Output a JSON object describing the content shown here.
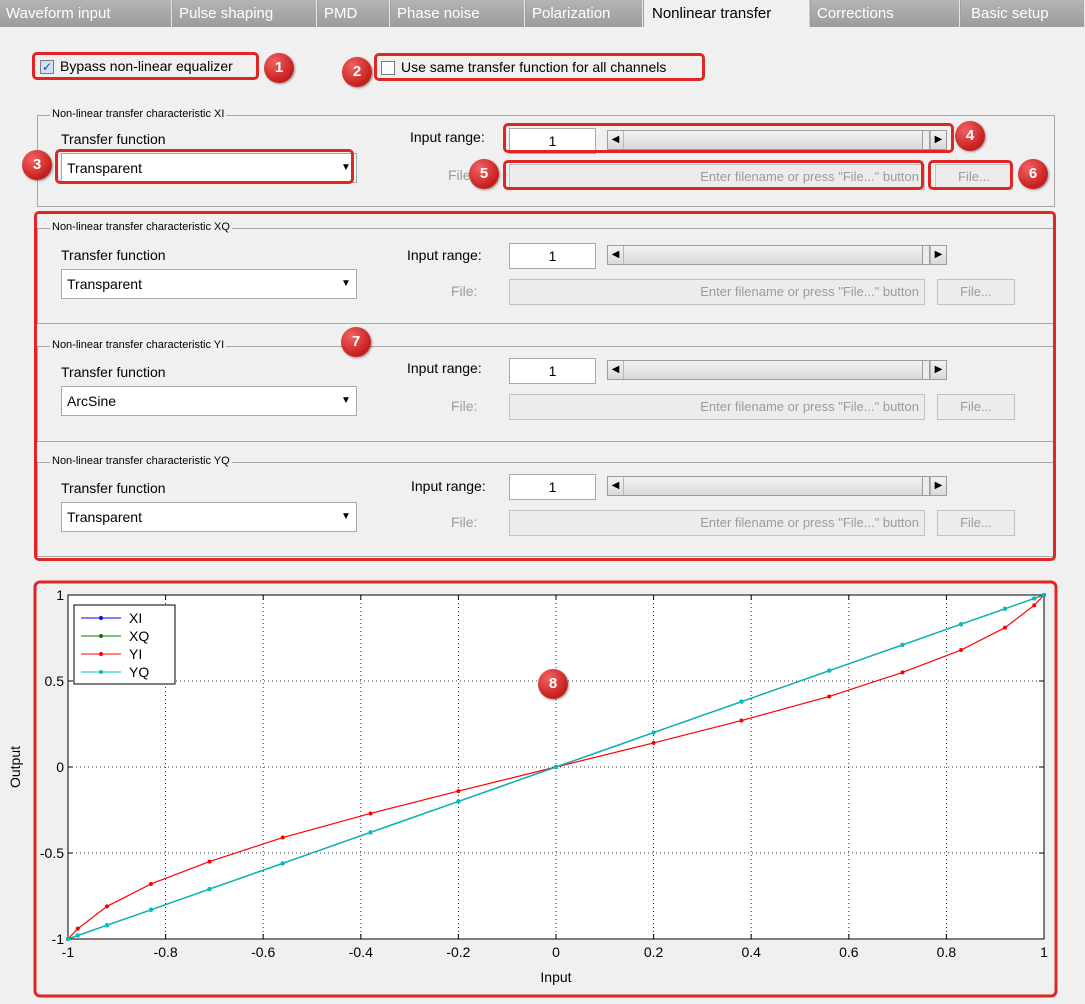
{
  "tabs": [
    "Waveform input",
    "Pulse shaping",
    "PMD",
    "Phase noise",
    "Polarization",
    "Nonlinear transfer",
    "Corrections",
    "Basic setup"
  ],
  "active_tab": "Nonlinear transfer",
  "bypass": {
    "label": "Bypass non-linear equalizer",
    "checked": true
  },
  "same_function": {
    "label": "Use same transfer function for all channels",
    "checked": false
  },
  "panels": [
    {
      "title": "Non-linear transfer characteristic XI",
      "tf_label": "Transfer function",
      "tf_value": "Transparent",
      "range_label": "Input range:",
      "range_value": "1",
      "file_label": "File:",
      "file_placeholder": "Enter filename or press \"File...\" button",
      "file_button": "File..."
    },
    {
      "title": "Non-linear transfer characteristic XQ",
      "tf_label": "Transfer function",
      "tf_value": "Transparent",
      "range_label": "Input range:",
      "range_value": "1",
      "file_label": "File:",
      "file_placeholder": "Enter filename or press \"File...\" button",
      "file_button": "File..."
    },
    {
      "title": "Non-linear transfer characteristic YI",
      "tf_label": "Transfer function",
      "tf_value": "ArcSine",
      "range_label": "Input range:",
      "range_value": "1",
      "file_label": "File:",
      "file_placeholder": "Enter filename or press \"File...\" button",
      "file_button": "File..."
    },
    {
      "title": "Non-linear transfer characteristic YQ",
      "tf_label": "Transfer function",
      "tf_value": "Transparent",
      "range_label": "Input range:",
      "range_value": "1",
      "file_label": "File:",
      "file_placeholder": "Enter filename or press \"File...\" button",
      "file_button": "File..."
    }
  ],
  "markers": [
    "1",
    "2",
    "3",
    "4",
    "5",
    "6",
    "7",
    "8"
  ],
  "colors": {
    "highlight": "#e02525",
    "XI": "#0000ff",
    "XQ": "#008000",
    "YI": "#ff0000",
    "YQ": "#00bfbf"
  },
  "chart_data": {
    "type": "line",
    "xlabel": "Input",
    "ylabel": "Output",
    "xlim": [
      -1,
      1
    ],
    "ylim": [
      -1,
      1
    ],
    "xticks": [
      "-1",
      "-0.8",
      "-0.6",
      "-0.4",
      "-0.2",
      "0",
      "0.2",
      "0.4",
      "0.6",
      "0.8",
      "1"
    ],
    "yticks": [
      "-1",
      "-0.5",
      "0",
      "0.5",
      "1"
    ],
    "grid": true,
    "legend_position": "top-left",
    "series": [
      {
        "name": "XI",
        "x": [
          -1,
          -0.98,
          -0.92,
          -0.83,
          -0.71,
          -0.56,
          -0.38,
          -0.2,
          0,
          0.2,
          0.38,
          0.56,
          0.71,
          0.83,
          0.92,
          0.98,
          1
        ],
        "y": [
          -1,
          -0.98,
          -0.92,
          -0.83,
          -0.71,
          -0.56,
          -0.38,
          -0.2,
          0,
          0.2,
          0.38,
          0.56,
          0.71,
          0.83,
          0.92,
          0.98,
          1
        ]
      },
      {
        "name": "XQ",
        "x": [
          -1,
          -0.98,
          -0.92,
          -0.83,
          -0.71,
          -0.56,
          -0.38,
          -0.2,
          0,
          0.2,
          0.38,
          0.56,
          0.71,
          0.83,
          0.92,
          0.98,
          1
        ],
        "y": [
          -1,
          -0.98,
          -0.92,
          -0.83,
          -0.71,
          -0.56,
          -0.38,
          -0.2,
          0,
          0.2,
          0.38,
          0.56,
          0.71,
          0.83,
          0.92,
          0.98,
          1
        ]
      },
      {
        "name": "YI",
        "x": [
          -1,
          -0.98,
          -0.92,
          -0.83,
          -0.71,
          -0.56,
          -0.38,
          -0.2,
          0,
          0.2,
          0.38,
          0.56,
          0.71,
          0.83,
          0.92,
          0.98,
          1
        ],
        "y": [
          -1,
          -0.94,
          -0.81,
          -0.68,
          -0.55,
          -0.41,
          -0.27,
          -0.14,
          0,
          0.14,
          0.27,
          0.41,
          0.55,
          0.68,
          0.81,
          0.94,
          1
        ]
      },
      {
        "name": "YQ",
        "x": [
          -1,
          -0.98,
          -0.92,
          -0.83,
          -0.71,
          -0.56,
          -0.38,
          -0.2,
          0,
          0.2,
          0.38,
          0.56,
          0.71,
          0.83,
          0.92,
          0.98,
          1
        ],
        "y": [
          -1,
          -0.98,
          -0.92,
          -0.83,
          -0.71,
          -0.56,
          -0.38,
          -0.2,
          0,
          0.2,
          0.38,
          0.56,
          0.71,
          0.83,
          0.92,
          0.98,
          1
        ]
      }
    ]
  }
}
